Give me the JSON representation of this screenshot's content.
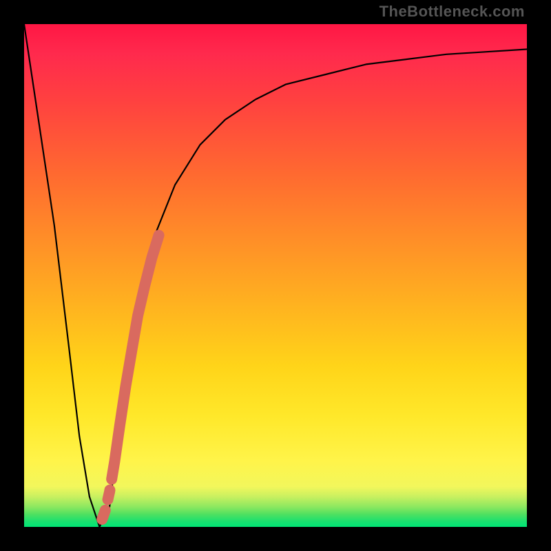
{
  "watermark": "TheBottleneck.com",
  "chart_data": {
    "type": "line",
    "title": "",
    "xlabel": "",
    "ylabel": "",
    "xlim": [
      0,
      100
    ],
    "ylim": [
      0,
      100
    ],
    "series": [
      {
        "name": "bottleneck-curve",
        "x": [
          0,
          6,
          9,
          11,
          13,
          15,
          17,
          18,
          19,
          22,
          26,
          30,
          35,
          40,
          46,
          52,
          60,
          68,
          76,
          84,
          92,
          100
        ],
        "values": [
          100,
          60,
          35,
          18,
          6,
          0,
          4,
          12,
          22,
          42,
          58,
          68,
          76,
          81,
          85,
          88,
          90,
          92,
          93,
          94,
          94.5,
          95
        ]
      }
    ],
    "highlight_segment": {
      "name": "highlight-range",
      "color": "#d96a5f",
      "x": [
        15.5,
        16.2,
        17.0,
        18.0,
        19.0,
        20.2,
        21.4,
        22.6,
        24.0,
        25.4,
        26.8
      ],
      "values": [
        1.5,
        3.5,
        7.0,
        13.0,
        20.0,
        28.0,
        35.0,
        42.0,
        48.0,
        53.5,
        58.0
      ]
    }
  }
}
